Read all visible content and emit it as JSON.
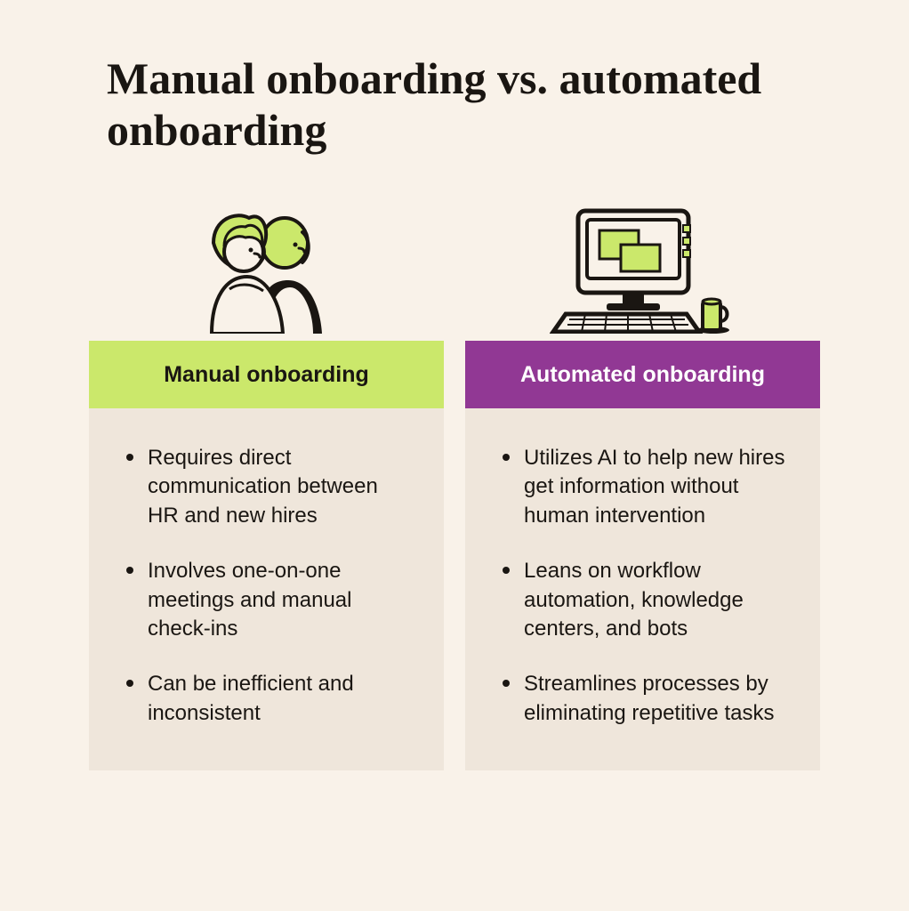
{
  "title": "Manual onboarding vs. automated onboarding",
  "columns": {
    "manual": {
      "header": "Manual onboarding",
      "header_bg": "#cbe86b",
      "items": [
        "Requires direct communication between HR and new hires",
        "Involves one-on-one meetings and manual check-ins",
        "Can be inefficient and inconsistent"
      ],
      "icon": "people-icon"
    },
    "automated": {
      "header": "Automated onboarding",
      "header_bg": "#913894",
      "items": [
        "Utilizes AI to help new hires get information without human intervention",
        "Leans on workflow automation, knowledge centers, and bots",
        "Streamlines processes by eliminating repetitive tasks"
      ],
      "icon": "computer-icon"
    }
  }
}
